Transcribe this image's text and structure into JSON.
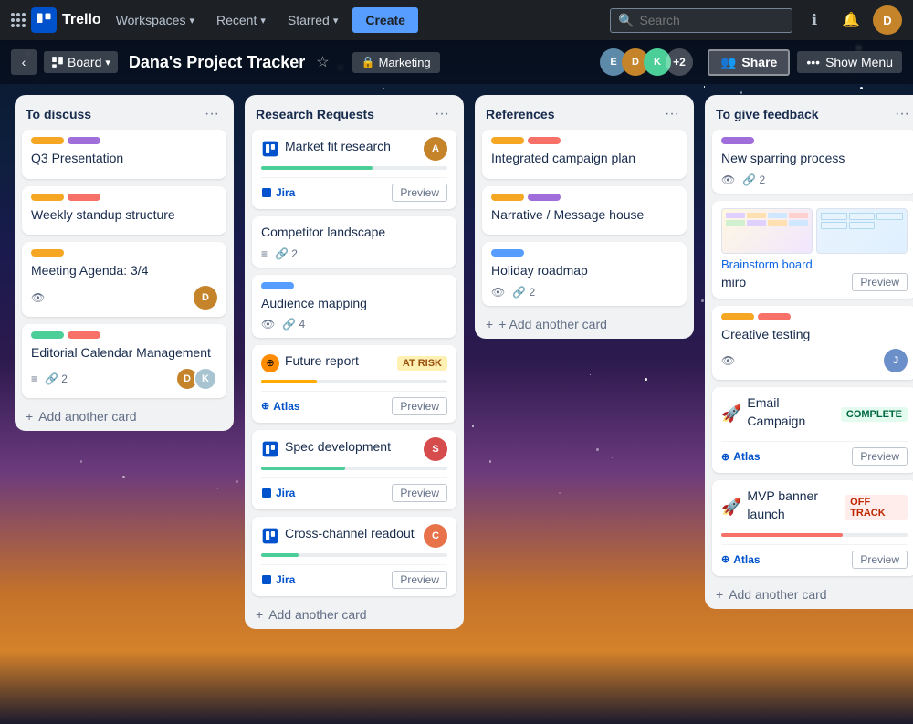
{
  "topnav": {
    "logo_text": "Trello",
    "workspaces_label": "Workspaces",
    "recent_label": "Recent",
    "starred_label": "Starred",
    "create_label": "Create",
    "search_placeholder": "Search",
    "info_icon": "ℹ",
    "bell_icon": "🔔"
  },
  "boardnav": {
    "back_icon": "‹",
    "board_type_label": "Board",
    "board_title": "Dana's Project Tracker",
    "star_icon": "☆",
    "workspace_icon": "🔒",
    "workspace_label": "Marketing",
    "members_plus": "+2",
    "share_icon": "👥",
    "share_label": "Share",
    "menu_dots": "•••",
    "show_menu_label": "Show Menu"
  },
  "columns": [
    {
      "id": "to-discuss",
      "title": "To discuss",
      "cards": [
        {
          "id": "q3",
          "labels": [
            {
              "color": "#f5a623"
            },
            {
              "color": "#a06eda"
            }
          ],
          "title": "Q3 Presentation",
          "meta": []
        },
        {
          "id": "weekly",
          "labels": [
            {
              "color": "#f5a623"
            },
            {
              "color": "#f87168"
            }
          ],
          "title": "Weekly standup structure",
          "meta": []
        },
        {
          "id": "meeting",
          "labels": [
            {
              "color": "#f5a623"
            }
          ],
          "title": "Meeting Agenda: 3/4",
          "meta": [
            {
              "icon": "👁",
              "count": ""
            }
          ],
          "has_avatar": true,
          "avatar_color": "#c5832a",
          "avatar_text": "D"
        },
        {
          "id": "editorial",
          "labels": [
            {
              "color": "#4bce97"
            },
            {
              "color": "#f87168"
            }
          ],
          "title": "Editorial Calendar Management",
          "meta": [
            {
              "icon": "≡",
              "count": ""
            },
            {
              "icon": "🔗",
              "count": "2"
            }
          ],
          "has_double_avatar": true,
          "avatar1_color": "#c5832a",
          "avatar1_text": "D",
          "avatar2_color": "#a8c4d0",
          "avatar2_text": "K"
        }
      ],
      "add_label": "Add another card"
    },
    {
      "id": "research",
      "title": "Research Requests",
      "cards": [
        {
          "id": "market",
          "type": "jira",
          "has_icon": true,
          "icon_type": "jira-square",
          "title": "Market fit research",
          "has_avatar": true,
          "avatar_color": "#c5832a",
          "avatar_text": "A",
          "integration": "Jira",
          "show_preview": true,
          "progress_bar": true,
          "progress_pct": 60
        },
        {
          "id": "competitor",
          "title": "Competitor landscape",
          "meta": [
            {
              "icon": "≡",
              "count": ""
            },
            {
              "icon": "🔗",
              "count": "2"
            }
          ]
        },
        {
          "id": "audience",
          "labels": [
            {
              "color": "#579dff"
            }
          ],
          "title": "Audience mapping",
          "meta": [
            {
              "icon": "👁",
              "count": ""
            },
            {
              "icon": "🔗",
              "count": "4"
            }
          ]
        },
        {
          "id": "future",
          "type": "atlas",
          "has_icon": true,
          "icon_type": "atlas",
          "title": "Future report",
          "badge": "AT RISK",
          "badge_type": "at-risk",
          "integration": "Atlas",
          "show_preview": true,
          "progress_bar": true,
          "progress_pct": 30
        },
        {
          "id": "spec",
          "type": "jira",
          "has_icon": true,
          "icon_type": "jira-square",
          "title": "Spec development",
          "has_avatar": true,
          "avatar_color": "#d64b4b",
          "avatar_text": "S",
          "integration": "Jira",
          "show_preview": true,
          "progress_bar": true,
          "progress_pct": 45
        },
        {
          "id": "cross",
          "type": "jira",
          "has_icon": true,
          "icon_type": "jira-square",
          "title": "Cross-channel readout",
          "has_avatar": true,
          "avatar_color": "#e8734a",
          "avatar_text": "C",
          "integration": "Jira",
          "show_preview": true,
          "progress_bar": true,
          "progress_pct": 20
        }
      ],
      "add_label": "Add another card"
    },
    {
      "id": "references",
      "title": "References",
      "cards": [
        {
          "id": "campaign",
          "labels": [
            {
              "color": "#f5a623"
            },
            {
              "color": "#f87168"
            }
          ],
          "title": "Integrated campaign plan"
        },
        {
          "id": "narrative",
          "labels": [
            {
              "color": "#f5a623"
            },
            {
              "color": "#a06eda"
            }
          ],
          "title": "Narrative / Message house"
        },
        {
          "id": "holiday",
          "labels": [
            {
              "color": "#579dff"
            }
          ],
          "title": "Holiday roadmap",
          "meta": [
            {
              "icon": "👁",
              "count": ""
            },
            {
              "icon": "🔗",
              "count": "2"
            }
          ]
        }
      ],
      "add_label": "Add another card"
    },
    {
      "id": "feedback",
      "title": "To give feedback",
      "cards": [
        {
          "id": "sparring",
          "labels": [
            {
              "color": "#a06eda"
            }
          ],
          "title": "New sparring process",
          "meta": [
            {
              "icon": "👁",
              "count": ""
            },
            {
              "icon": "🔗",
              "count": "2"
            }
          ]
        },
        {
          "id": "brainstorm",
          "type": "miro",
          "has_preview": true,
          "link_text": "Brainstorm board",
          "app_text": "miro",
          "show_preview": true
        },
        {
          "id": "creative",
          "labels": [
            {
              "color": "#f5a623"
            },
            {
              "color": "#f87168"
            }
          ],
          "title": "Creative testing",
          "meta": [
            {
              "icon": "👁",
              "count": ""
            }
          ],
          "has_avatar": true,
          "avatar_color": "#6b8fc9",
          "avatar_text": "J"
        },
        {
          "id": "email",
          "type": "atlas",
          "has_icon": true,
          "icon_type": "rocket",
          "title": "Email Campaign",
          "badge": "COMPLETE",
          "badge_type": "complete",
          "integration": "Atlas",
          "show_preview": true
        },
        {
          "id": "mvp",
          "type": "atlas",
          "has_icon": true,
          "icon_type": "rocket",
          "title": "MVP banner launch",
          "badge": "OFF TRACK",
          "badge_type": "off-track",
          "integration": "Atlas",
          "show_preview": true,
          "progress_bar": true,
          "progress_pct": 65
        }
      ],
      "add_label": "Add another card"
    }
  ]
}
